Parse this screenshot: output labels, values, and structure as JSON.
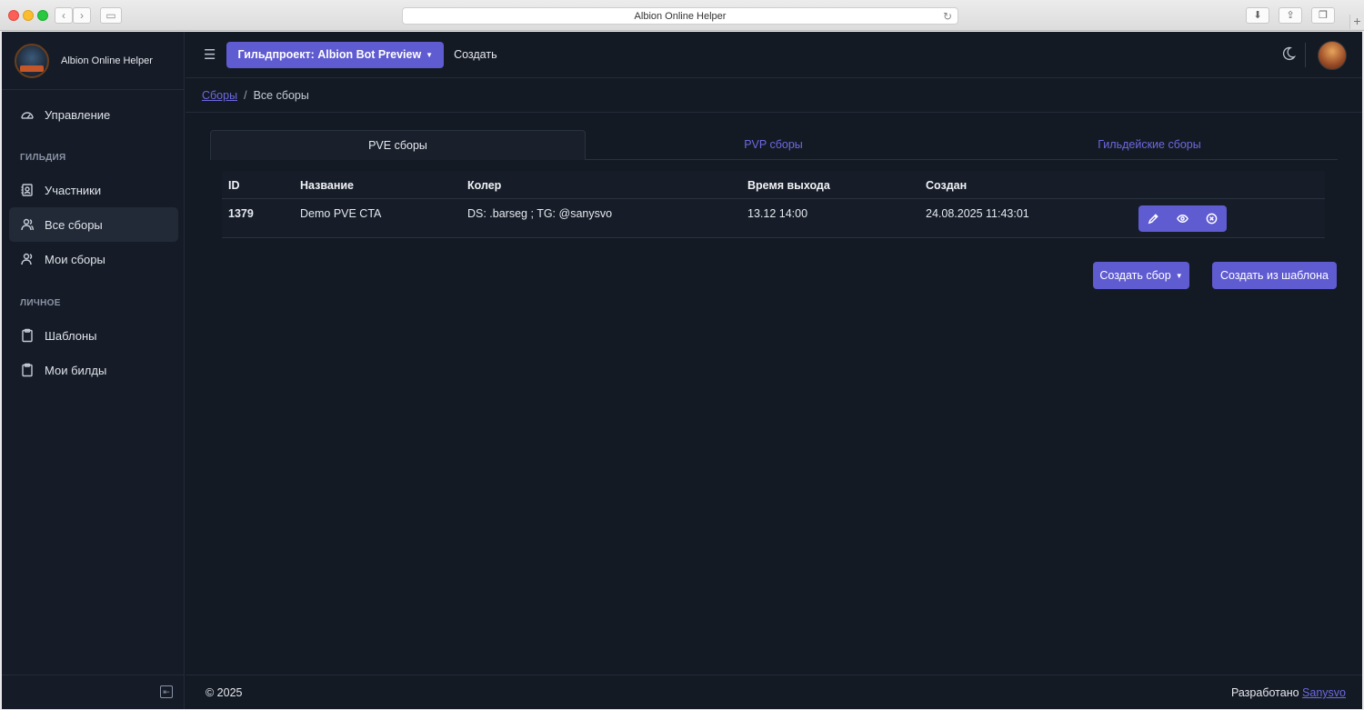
{
  "browser": {
    "url_title": "Albion Online Helper"
  },
  "sidebar": {
    "brand": "Albion Online Helper",
    "items": [
      {
        "label": "Управление",
        "icon": "dashboard-icon"
      },
      {
        "label": "Участники",
        "icon": "contacts-icon"
      },
      {
        "label": "Все сборы",
        "icon": "users-icon",
        "active": true
      },
      {
        "label": "Мои сборы",
        "icon": "user-icon"
      },
      {
        "label": "Шаблоны",
        "icon": "clipboard-icon"
      },
      {
        "label": "Мои билды",
        "icon": "clipboard-icon"
      }
    ],
    "sections": {
      "guild": "ГИЛЬДИЯ",
      "personal": "ЛИЧНОЕ"
    }
  },
  "topbar": {
    "guild_button": "Гильдпроект: Albion Bot Preview",
    "create_link": "Создать"
  },
  "breadcrumb": {
    "root": "Сборы",
    "separator": "/",
    "current": "Все сборы"
  },
  "tabs": [
    {
      "label": "PVE сборы",
      "active": true
    },
    {
      "label": "PVP сборы"
    },
    {
      "label": "Гильдейские сборы"
    }
  ],
  "table": {
    "headers": {
      "id": "ID",
      "name": "Название",
      "caller": "Колер",
      "time": "Время выхода",
      "created": "Создан"
    },
    "rows": [
      {
        "id": "1379",
        "name": "Demo PVE CTA",
        "caller": "DS: .barseg ; TG: @sanysvo",
        "time": "13.12 14:00",
        "created": "24.08.2025 11:43:01"
      }
    ]
  },
  "buttons": {
    "create": "Создать сбор",
    "from_template": "Создать из шаблона"
  },
  "footer": {
    "copyright": "© 2025",
    "developed_by": "Разработано",
    "author": "Sanysvo"
  },
  "colors": {
    "accent": "#5f5bd1",
    "link": "#6c69e0",
    "background": "#141a24",
    "sidebar": "#161c27"
  }
}
